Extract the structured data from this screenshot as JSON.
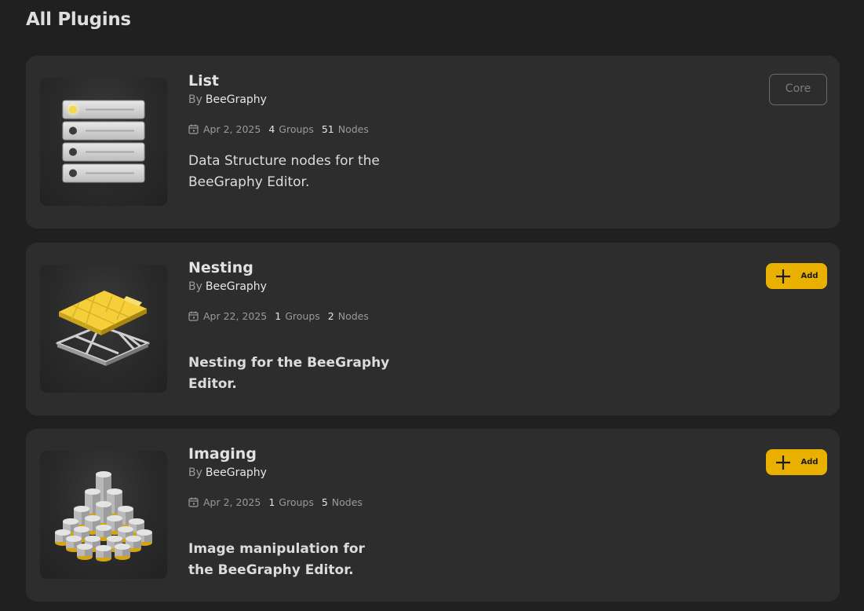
{
  "page": {
    "title": "All Plugins"
  },
  "plugins": [
    {
      "name": "List",
      "by_label": "By",
      "author": "BeeGraphy",
      "date": "Apr 2, 2025",
      "groups_count": "4",
      "groups_label": "Groups",
      "nodes_count": "51",
      "nodes_label": "Nodes",
      "description": "Data Structure nodes for the BeeGraphy Editor.",
      "action": "Core",
      "thumbnail_icon": "list-stack-icon"
    },
    {
      "name": "Nesting",
      "by_label": "By",
      "author": "BeeGraphy",
      "date": "Apr 22, 2025",
      "groups_count": "1",
      "groups_label": "Groups",
      "nodes_count": "2",
      "nodes_label": "Nodes",
      "description": "Nesting for the BeeGraphy Editor.",
      "action": "Add",
      "thumbnail_icon": "nesting-sheets-icon"
    },
    {
      "name": "Imaging",
      "by_label": "By",
      "author": "BeeGraphy",
      "date": "Apr 2, 2025",
      "groups_count": "1",
      "groups_label": "Groups",
      "nodes_count": "5",
      "nodes_label": "Nodes",
      "description": "Image manipulation for the BeeGraphy Editor.",
      "action": "Add",
      "thumbnail_icon": "cylinder-grid-icon"
    }
  ],
  "colors": {
    "background": "#202020",
    "card": "#2d2d2d",
    "accent": "#eab000",
    "muted_text": "#9a9a9a"
  }
}
